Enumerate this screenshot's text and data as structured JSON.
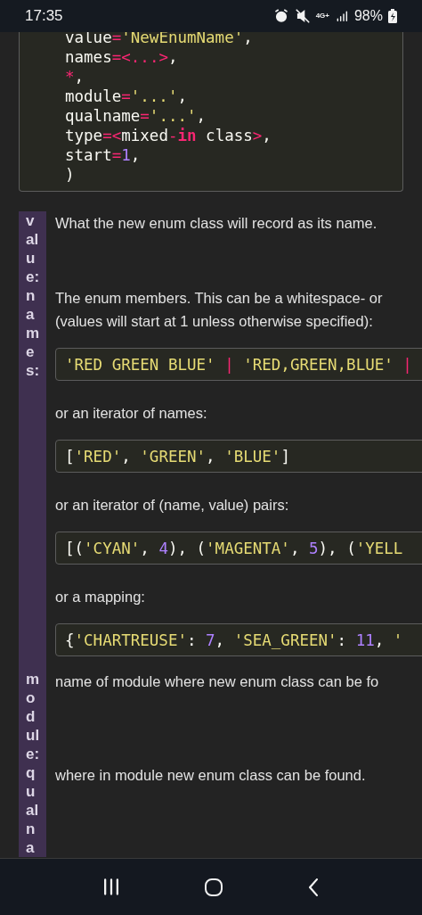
{
  "status_bar": {
    "time": "17:35",
    "network": "4G+",
    "battery": "98%"
  },
  "signature_code": [
    "value='NewEnumName',",
    "names=<...>,",
    "*,",
    "module='...',",
    "qualname='...',",
    "type=<mixed-in class>,",
    "start=1,",
    ")"
  ],
  "fields": [
    {
      "term": "value:",
      "content": [
        {
          "kind": "text",
          "text": "What the new enum class will record as its name."
        }
      ]
    },
    {
      "term": "names:",
      "content": [
        {
          "kind": "text",
          "text": "The enum members. This can be a whitespace- or\n(values will start at 1 unless otherwise specified):"
        },
        {
          "kind": "code",
          "text": "'RED GREEN BLUE' | 'RED,GREEN,BLUE' |"
        },
        {
          "kind": "text",
          "text": "or an iterator of names:"
        },
        {
          "kind": "code",
          "text": "['RED', 'GREEN', 'BLUE']"
        },
        {
          "kind": "text",
          "text": "or an iterator of (name, value) pairs:"
        },
        {
          "kind": "code",
          "text": "[('CYAN', 4), ('MAGENTA', 5), ('YELL"
        },
        {
          "kind": "text",
          "text": "or a mapping:"
        },
        {
          "kind": "code",
          "text": "{'CHARTREUSE': 7, 'SEA_GREEN': 11, '"
        }
      ]
    },
    {
      "term": "module:",
      "content": [
        {
          "kind": "text",
          "text": "name of module where new enum class can be fo"
        }
      ]
    },
    {
      "term": "qualna",
      "content": [
        {
          "kind": "text",
          "text": "where in module new enum class can be found."
        }
      ]
    }
  ]
}
